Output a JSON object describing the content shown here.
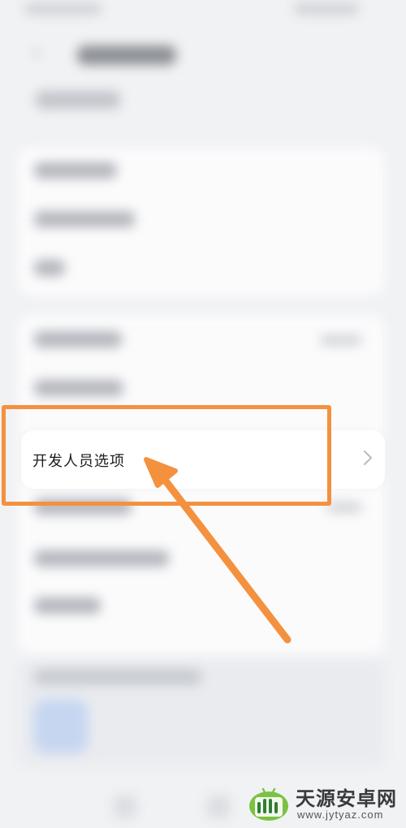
{
  "settings": {
    "developer_options": {
      "label": "开发人员选项",
      "chevron_icon": "chevron-right-icon"
    }
  },
  "annotation": {
    "highlight_color": "#f4913f"
  },
  "watermark": {
    "title": "天源安卓网",
    "url": "www.jytyaz.com",
    "logo_icon": "android-logo-icon"
  }
}
